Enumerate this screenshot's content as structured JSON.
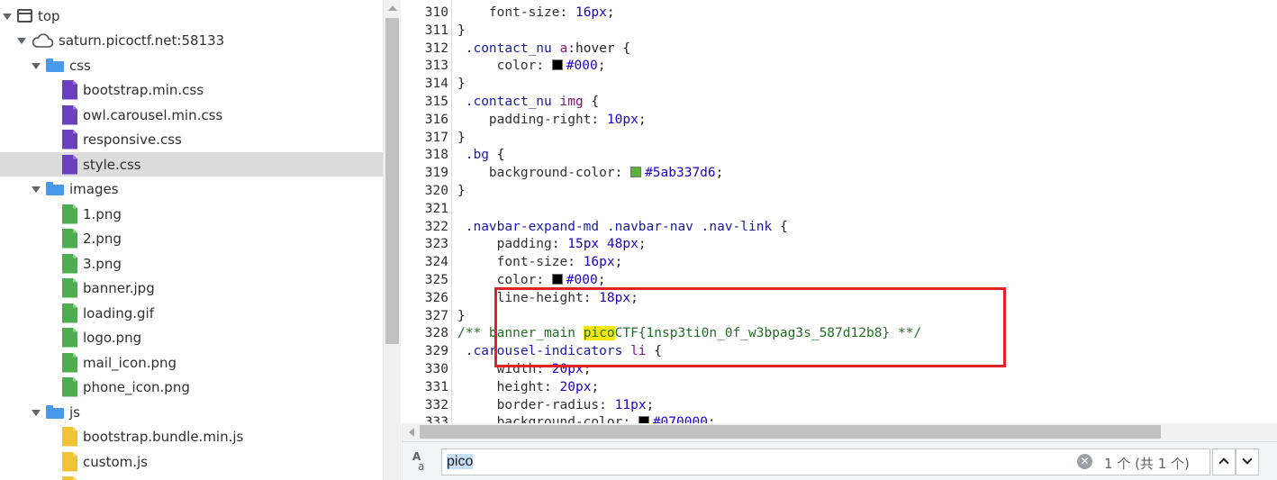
{
  "tree": {
    "root_label": "top",
    "host_label": "saturn.picoctf.net:58133",
    "folders": {
      "css": "css",
      "images": "images",
      "js": "js"
    },
    "css_files": [
      "bootstrap.min.css",
      "owl.carousel.min.css",
      "responsive.css",
      "style.css"
    ],
    "image_files": [
      "1.png",
      "2.png",
      "3.png",
      "banner.jpg",
      "loading.gif",
      "logo.png",
      "mail_icon.png",
      "phone_icon.png"
    ],
    "js_files": [
      "bootstrap.bundle.min.js",
      "custom.js"
    ],
    "selected_file": "style.css"
  },
  "editor": {
    "lines": [
      {
        "n": "310",
        "t": "    font-size: 16px;"
      },
      {
        "n": "311",
        "t": "}"
      },
      {
        "n": "312",
        "t": " .contact_nu a:hover {"
      },
      {
        "n": "313",
        "t": "     color: #000;"
      },
      {
        "n": "314",
        "t": "}"
      },
      {
        "n": "315",
        "t": " .contact_nu img {"
      },
      {
        "n": "316",
        "t": "    padding-right: 10px;"
      },
      {
        "n": "317",
        "t": "}"
      },
      {
        "n": "318",
        "t": " .bg {"
      },
      {
        "n": "319",
        "t": "    background-color: #5ab337d6;"
      },
      {
        "n": "320",
        "t": "}"
      },
      {
        "n": "321",
        "t": ""
      },
      {
        "n": "322",
        "t": " .navbar-expand-md .navbar-nav .nav-link {"
      },
      {
        "n": "323",
        "t": "     padding: 15px 48px;"
      },
      {
        "n": "324",
        "t": "     font-size: 16px;"
      },
      {
        "n": "325",
        "t": "     color: #000;"
      },
      {
        "n": "326",
        "t": "     line-height: 18px;"
      },
      {
        "n": "327",
        "t": "}"
      },
      {
        "n": "328",
        "t": "/** banner_main picoCTF{1nsp3ti0n_0f_w3bpag3s_587d12b8} **/"
      },
      {
        "n": "329",
        "t": " .carousel-indicators li {"
      },
      {
        "n": "330",
        "t": "     width: 20px;"
      },
      {
        "n": "331",
        "t": "     height: 20px;"
      },
      {
        "n": "332",
        "t": "     border-radius: 11px;"
      },
      {
        "n": "333",
        "t": "     background-color: #070000;"
      }
    ],
    "colors": {
      "black_swatch": "#000000",
      "green_swatch": "#5ab337",
      "highlight": "#f6e60e",
      "annotation_box": "#e02424"
    }
  },
  "search": {
    "case_icon": "match-case-icon",
    "query": "pico",
    "match_count": "1 个 (共 1 个)"
  }
}
